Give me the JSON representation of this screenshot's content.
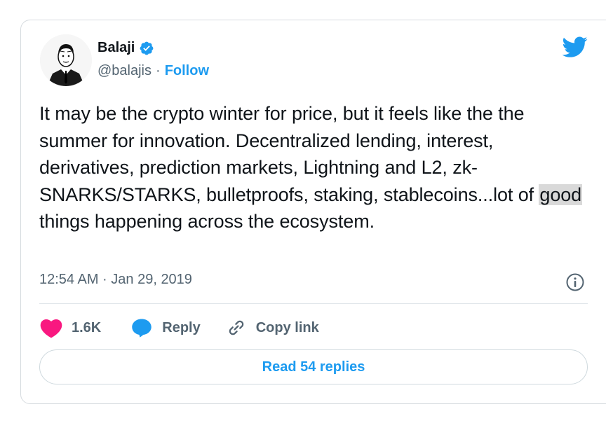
{
  "author": {
    "name": "Balaji",
    "handle": "@balajis",
    "separator": "·",
    "follow_label": "Follow"
  },
  "tweet": {
    "text_before": "It may be the crypto winter for price, but it feels like the the summer for innovation. Decentralized lending, interest, derivatives, prediction markets, Lightning and L2, zk-SNARKS/STARKS, bulletproofs, staking, stablecoins...lot of ",
    "highlight": "good",
    "text_after": " things happening across the ecosystem.",
    "timestamp": "12:54 AM · Jan 29, 2019"
  },
  "actions": {
    "like_count": "1.6K",
    "reply_label": "Reply",
    "copy_link_label": "Copy link"
  },
  "read_replies_label": "Read 54 replies",
  "icons": [
    "verified-badge-icon",
    "twitter-bird-icon",
    "info-icon",
    "heart-icon",
    "reply-bubble-icon",
    "link-icon"
  ],
  "colors": {
    "accent": "#1d9bf0",
    "like": "#f91880",
    "muted": "#536471",
    "text": "#0f1419",
    "highlight": "#d9d9d9"
  }
}
